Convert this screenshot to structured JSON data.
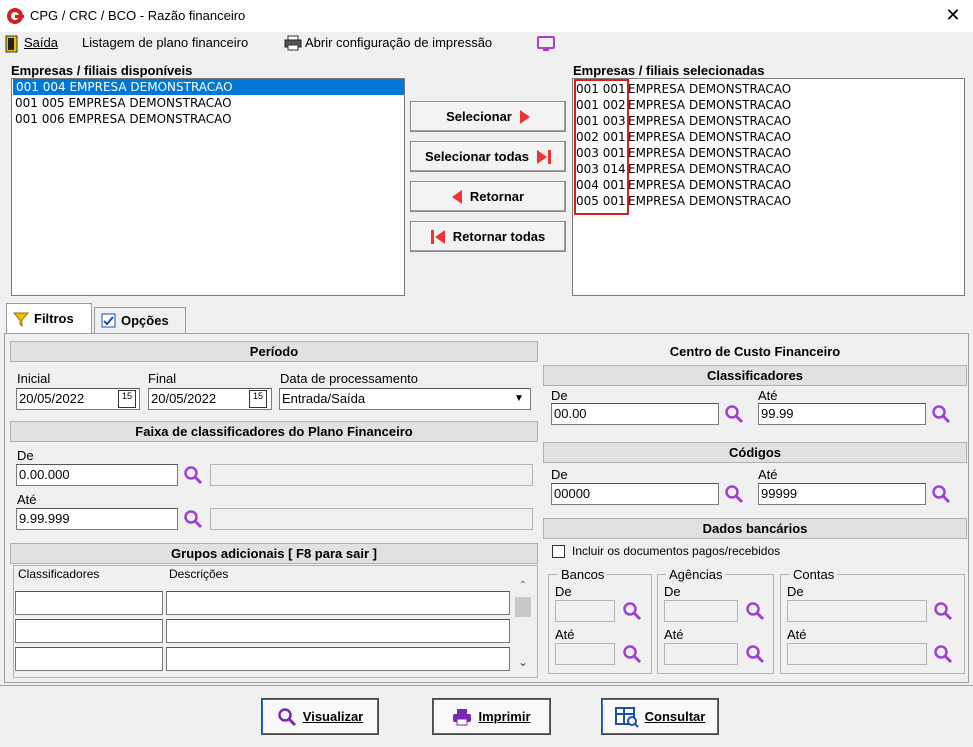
{
  "window": {
    "title": "CPG / CRC / BCO - Razão financeiro",
    "close": "✕"
  },
  "menu": {
    "exit": "Saída",
    "listing": "Listagem de plano financeiro",
    "print_config": "Abrir configuração de impressão"
  },
  "available": {
    "label": "Empresas / filiais disponíveis",
    "items": [
      "001 004 EMPRESA DEMONSTRACAO",
      "001 005 EMPRESA DEMONSTRACAO",
      "001 006 EMPRESA DEMONSTRACAO"
    ]
  },
  "selected": {
    "label": "Empresas / filiais selecionadas",
    "items": [
      {
        "code": "001 001",
        "name": "EMPRESA DEMONSTRACAO"
      },
      {
        "code": "001 002",
        "name": "EMPRESA DEMONSTRACAO"
      },
      {
        "code": "001 003",
        "name": "EMPRESA DEMONSTRACAO"
      },
      {
        "code": "002 001",
        "name": "EMPRESA DEMONSTRACAO"
      },
      {
        "code": "003 001",
        "name": "EMPRESA DEMONSTRACAO"
      },
      {
        "code": "003 014",
        "name": "EMPRESA DEMONSTRACAO"
      },
      {
        "code": "004 001",
        "name": "EMPRESA DEMONSTRACAO"
      },
      {
        "code": "005 001",
        "name": "EMPRESA DEMONSTRACAO"
      }
    ]
  },
  "transfer": {
    "select": "Selecionar",
    "select_all": "Selecionar todas",
    "back": "Retornar",
    "back_all": "Retornar todas"
  },
  "tabs": {
    "filters": "Filtros",
    "options": "Opções"
  },
  "period": {
    "title": "Período",
    "initial_label": "Inicial",
    "initial": "20/05/2022",
    "final_label": "Final",
    "final": "20/05/2022",
    "proc_label": "Data de processamento",
    "proc": "Entrada/Saída",
    "cal": "15"
  },
  "range": {
    "title": "Faixa de classificadores do Plano Financeiro",
    "from_label": "De",
    "from": "0.00.000",
    "to_label": "Até",
    "to": "9.99.999"
  },
  "groups": {
    "title": "Grupos adicionais [ F8 para sair ]",
    "col1": "Classificadores",
    "col2": "Descrições"
  },
  "cost_center": {
    "title": "Centro de Custo Financeiro",
    "class_title": "Classificadores",
    "class_from_label": "De",
    "class_from": "00.00",
    "class_to_label": "Até",
    "class_to": "99.99",
    "codes_title": "Códigos",
    "codes_from_label": "De",
    "codes_from": "00000",
    "codes_to_label": "Até",
    "codes_to": "99999"
  },
  "bank": {
    "title": "Dados bancários",
    "include": "Incluir os documentos pagos/recebidos",
    "banks": "Bancos",
    "agencies": "Agências",
    "accounts": "Contas",
    "from": "De",
    "to": "Até"
  },
  "actions": {
    "view": "Visualizar",
    "print": "Imprimir",
    "query": "Consultar"
  },
  "colors": {
    "accent": "#0078d7",
    "highlight": "#d42020",
    "icon_purple": "#a040d0"
  }
}
